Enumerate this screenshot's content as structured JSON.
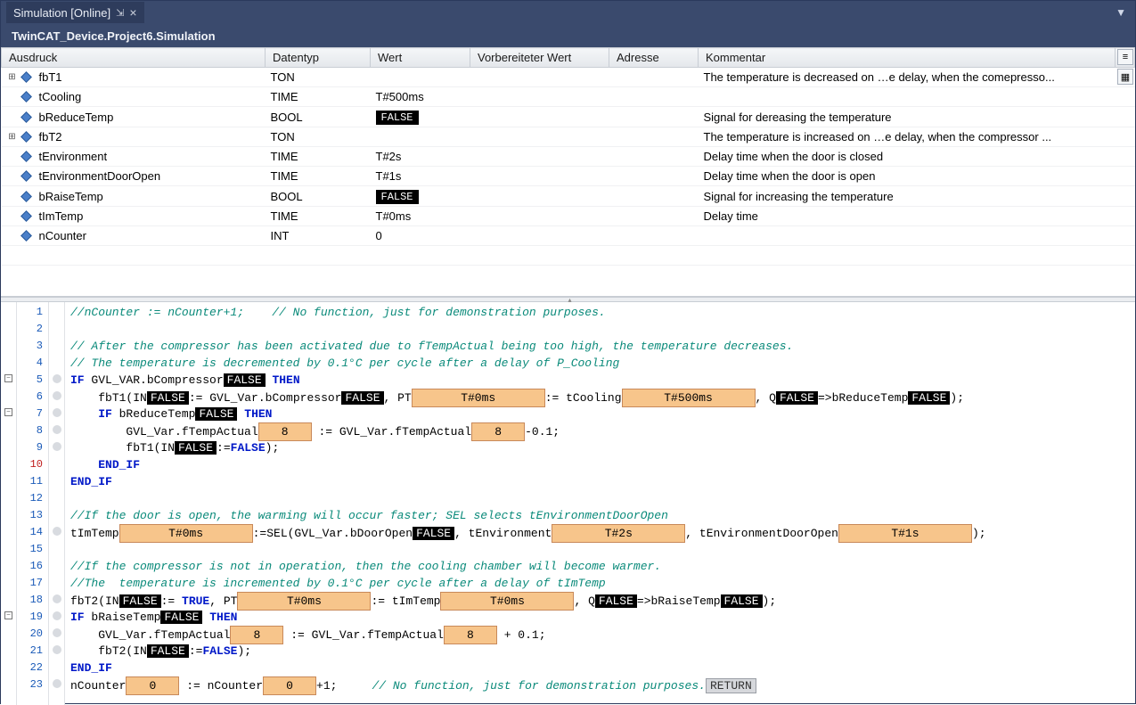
{
  "titlebar": {
    "tab_label": "Simulation [Online]"
  },
  "subhead": {
    "path": "TwinCAT_Device.Project6.Simulation"
  },
  "columns": {
    "expr": "Ausdruck",
    "type": "Datentyp",
    "value": "Wert",
    "prep": "Vorbereiteter Wert",
    "addr": "Adresse",
    "comment": "Kommentar"
  },
  "rows": [
    {
      "exp": "+",
      "name": "fbT1",
      "type": "TON",
      "value": "",
      "cmt": "The temperature is decreased on …e delay, when the comepresso..."
    },
    {
      "exp": "",
      "name": "tCooling",
      "type": "TIME",
      "value": "T#500ms",
      "cmt": ""
    },
    {
      "exp": "",
      "name": "bReduceTemp",
      "type": "BOOL",
      "value": "FALSE",
      "bool": true,
      "cmt": "Signal for dereasing the temperature"
    },
    {
      "exp": "+",
      "name": "fbT2",
      "type": "TON",
      "value": "",
      "cmt": "The temperature is increased on …e delay, when the compressor ..."
    },
    {
      "exp": "",
      "name": "tEnvironment",
      "type": "TIME",
      "value": "T#2s",
      "cmt": "Delay time when the door is closed"
    },
    {
      "exp": "",
      "name": "tEnvironmentDoorOpen",
      "type": "TIME",
      "value": "T#1s",
      "cmt": "Delay time when the door is open"
    },
    {
      "exp": "",
      "name": "bRaiseTemp",
      "type": "BOOL",
      "value": "FALSE",
      "bool": true,
      "cmt": "Signal for increasing the temperature"
    },
    {
      "exp": "",
      "name": "tImTemp",
      "type": "TIME",
      "value": "T#0ms",
      "cmt": "Delay time"
    },
    {
      "exp": "",
      "name": "nCounter",
      "type": "INT",
      "value": "0",
      "cmt": ""
    }
  ],
  "code": {
    "l1": "//nCounter := nCounter+1;    // No function, just for demonstration purposes.",
    "l3": "// After the compressor has been activated due to fTempActual being too high, the temperature decreases.",
    "l4": "// The temperature is decremented by 0.1°C per cycle after a delay of P_Cooling",
    "l5a": "IF",
    "l5b": " GVL_VAR.bCompressor",
    "l5v": "FALSE",
    "l5c": " THEN",
    "l6a": "fbT1(IN",
    "l6v1": "FALSE",
    "l6b": ":= GVL_Var.bCompressor",
    "l6v2": "FALSE",
    "l6c": ", PT",
    "l6pt": "T#0ms",
    "l6d": ":= tCooling",
    "l6tc": "T#500ms",
    "l6e": ", Q",
    "l6q": "FALSE",
    "l6f": "=>bReduceTemp",
    "l6r": "FALSE",
    "l6g": ");",
    "l7a": "IF",
    "l7b": " bReduceTemp",
    "l7v": "FALSE",
    "l7c": " THEN",
    "l8a": "GVL_Var.fTempActual",
    "l8v1": "8",
    "l8b": " := GVL_Var.fTempActual",
    "l8v2": "8",
    "l8c": "-0.1;",
    "l9a": "fbT1(IN",
    "l9v": "FALSE",
    "l9b": ":=",
    "l9c": "FALSE",
    "l9d": ");",
    "l10": "END_IF",
    "l11": "END_IF",
    "l13": "//If the door is open, the warming will occur faster; SEL selects tEnvironmentDoorOpen",
    "l14a": "tImTemp",
    "l14v1": "T#0ms",
    "l14b": ":=SEL",
    "l14c": "(GVL_Var.bDoorOpen",
    "l14v2": "FALSE",
    "l14d": ", tEnvironment",
    "l14v3": "T#2s",
    "l14e": ", tEnvironmentDoorOpen",
    "l14v4": "T#1s",
    "l14f": ");",
    "l16": "//If the compressor is not in operation, then the cooling chamber will become warmer.",
    "l17": "//The  temperature is incremented by 0.1°C per cycle after a delay of tImTemp",
    "l18a": "fbT2(IN",
    "l18v1": "FALSE",
    "l18b": ":= ",
    "l18c": "TRUE",
    "l18d": ", PT",
    "l18pt": "T#0ms",
    "l18e": ":= tImTemp",
    "l18ti": "T#0ms",
    "l18f": ", Q",
    "l18q": "FALSE",
    "l18g": "=>bRaiseTemp",
    "l18r": "FALSE",
    "l18h": ");",
    "l19a": "IF",
    "l19b": " bRaiseTemp",
    "l19v": "FALSE",
    "l19c": " THEN",
    "l20a": "GVL_Var.fTempActual",
    "l20v1": "8",
    "l20b": " := GVL_Var.fTempActual",
    "l20v2": "8",
    "l20c": " + 0.1;",
    "l21a": "fbT2(IN",
    "l21v": "FALSE",
    "l21b": ":=",
    "l21c": "FALSE",
    "l21d": ");",
    "l22": "END_IF",
    "l23a": "nCounter",
    "l23v1": "0",
    "l23b": " := nCounter",
    "l23v2": "0",
    "l23c": "+1;     ",
    "l23d": "// No function, just for demonstration purposes.",
    "l23ret": "RETURN"
  }
}
